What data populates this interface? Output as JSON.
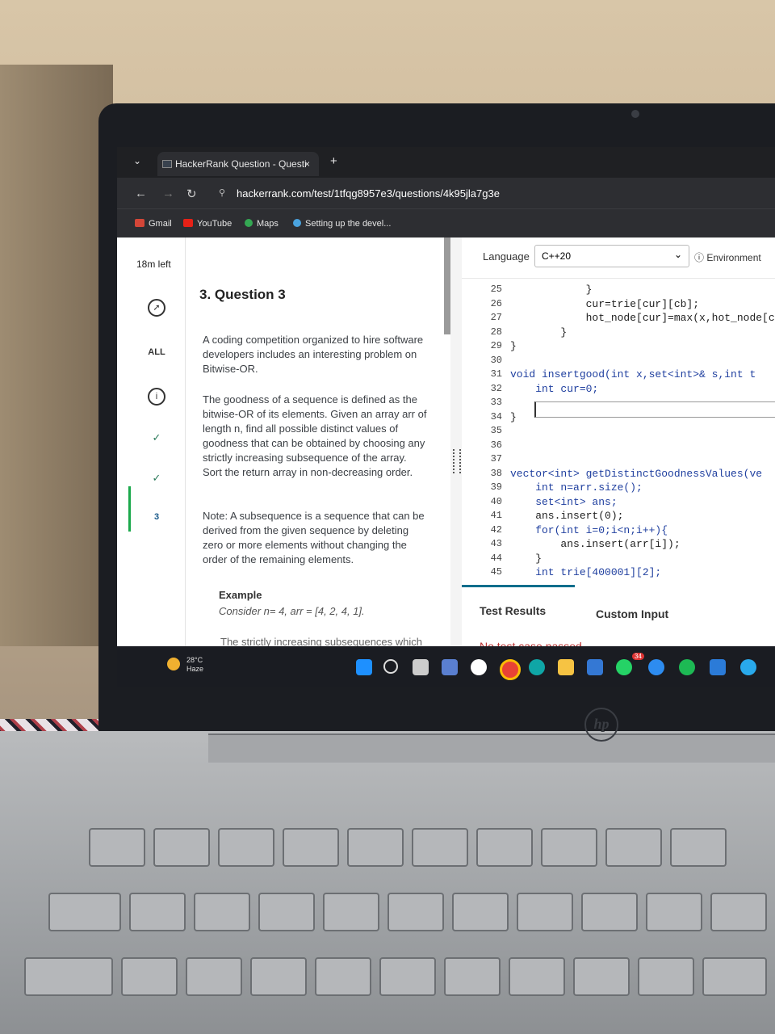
{
  "browser": {
    "tab_title": "HackerRank Question - Questi",
    "tab_close": "×",
    "new_tab": "+",
    "url": "hackerrank.com/test/1tfqg8957e3/questions/4k95jla7g3e",
    "bookmarks": [
      "Gmail",
      "YouTube",
      "Maps",
      "Setting up the devel..."
    ]
  },
  "leftnav": {
    "timer": "18m left",
    "all_label": "ALL",
    "info_icon": "i",
    "current_question": "3"
  },
  "question": {
    "title": "3. Question 3",
    "p1": "A coding competition organized to hire software developers includes an interesting problem on Bitwise-OR.",
    "p2": "The goodness of a sequence is defined as the bitwise-OR of its elements. Given an array arr of length n, find all possible distinct values of goodness that can be obtained by choosing any strictly increasing subsequence of the array. Sort the return array in non-decreasing order.",
    "note": "Note: A subsequence is a sequence that can be derived from the given sequence by deleting zero or more elements without changing the order of the remaining elements.",
    "example_heading": "Example",
    "example_text": "Consider n= 4, arr = [4, 2, 4, 1].",
    "truncated": "The strictly increasing subsequences which"
  },
  "editor": {
    "language_label": "Language",
    "language_value": "C++20",
    "environment_label": "Environment",
    "lines": [
      {
        "n": "25",
        "code": "            }"
      },
      {
        "n": "26",
        "code": "            cur=trie[cur][cb];"
      },
      {
        "n": "27",
        "code": "            hot_node[cur]=max(x,hot_node[c"
      },
      {
        "n": "28",
        "code": "        }"
      },
      {
        "n": "29",
        "code": "}"
      },
      {
        "n": "30",
        "code": ""
      },
      {
        "n": "31",
        "code": "void insertgood(int x,set<int>& s,int t"
      },
      {
        "n": "32",
        "code": "    int cur=0;"
      },
      {
        "n": "33",
        "code": ""
      },
      {
        "n": "34",
        "code": "}"
      },
      {
        "n": "35",
        "code": ""
      },
      {
        "n": "36",
        "code": ""
      },
      {
        "n": "37",
        "code": ""
      },
      {
        "n": "38",
        "code": "vector<int> getDistinctGoodnessValues(ve"
      },
      {
        "n": "39",
        "code": "    int n=arr.size();"
      },
      {
        "n": "40",
        "code": "    set<int> ans;"
      },
      {
        "n": "41",
        "code": "    ans.insert(0);"
      },
      {
        "n": "42",
        "code": "    for(int i=0;i<n;i++){"
      },
      {
        "n": "43",
        "code": "        ans.insert(arr[i]);"
      },
      {
        "n": "44",
        "code": "    }"
      },
      {
        "n": "45",
        "code": "    int trie[400001][2];"
      }
    ],
    "test_results_tab": "Test Results",
    "custom_input_tab": "Custom Input",
    "status": "No test case passed"
  },
  "taskbar": {
    "temperature": "28°C",
    "weather": "Haze",
    "badge": "34"
  },
  "laptop": {
    "brand": "hp"
  },
  "colors": {
    "accent": "#1ba94c",
    "tab_accent": "#0e6e8c",
    "browser_chrome": "#2d2e32"
  }
}
